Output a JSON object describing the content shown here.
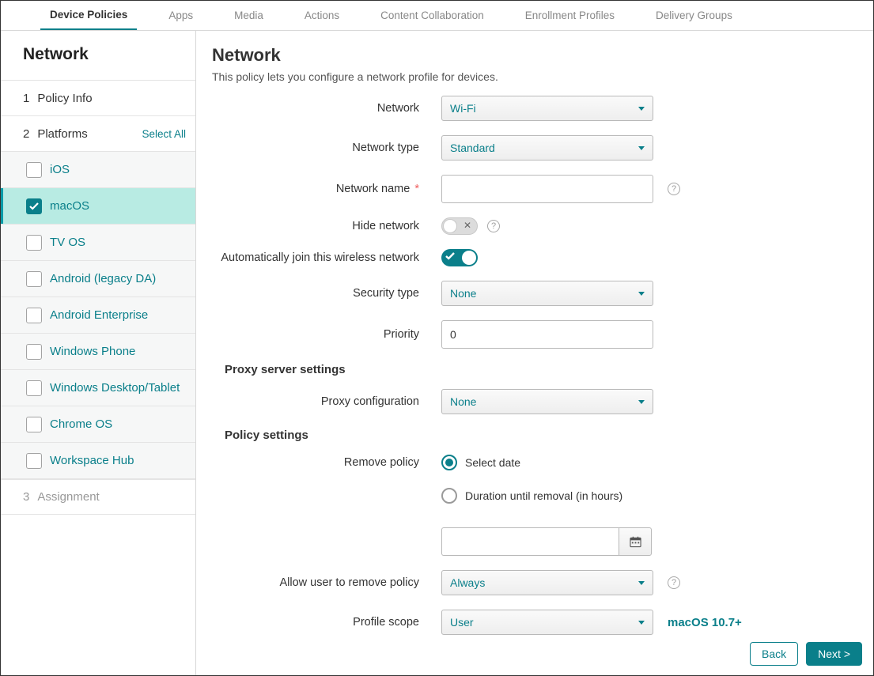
{
  "topbar": {
    "tabs": [
      "Device Policies",
      "Apps",
      "Media",
      "Actions",
      "Content Collaboration",
      "Enrollment Profiles",
      "Delivery Groups"
    ],
    "active": 0
  },
  "sidebar": {
    "title": "Network",
    "steps": {
      "policy_info": {
        "num": "1",
        "label": "Policy Info"
      },
      "platforms": {
        "num": "2",
        "label": "Platforms",
        "select_all": "Select All"
      },
      "assignment": {
        "num": "3",
        "label": "Assignment"
      }
    },
    "platforms": [
      {
        "label": "iOS",
        "checked": false
      },
      {
        "label": "macOS",
        "checked": true
      },
      {
        "label": "TV OS",
        "checked": false
      },
      {
        "label": "Android (legacy DA)",
        "checked": false
      },
      {
        "label": "Android Enterprise",
        "checked": false
      },
      {
        "label": "Windows Phone",
        "checked": false
      },
      {
        "label": "Windows Desktop/Tablet",
        "checked": false
      },
      {
        "label": "Chrome OS",
        "checked": false
      },
      {
        "label": "Workspace Hub",
        "checked": false
      }
    ]
  },
  "page": {
    "title": "Network",
    "description": "This policy lets you configure a network profile for devices."
  },
  "form": {
    "network": {
      "label": "Network",
      "value": "Wi-Fi"
    },
    "network_type": {
      "label": "Network type",
      "value": "Standard"
    },
    "network_name": {
      "label": "Network name",
      "value": "",
      "required": "*"
    },
    "hide_network": {
      "label": "Hide network",
      "value": false
    },
    "auto_join": {
      "label": "Automatically join this wireless network",
      "value": true
    },
    "security_type": {
      "label": "Security type",
      "value": "None"
    },
    "priority": {
      "label": "Priority",
      "value": "0"
    },
    "proxy_section": "Proxy server settings",
    "proxy_configuration": {
      "label": "Proxy configuration",
      "value": "None"
    },
    "policy_section": "Policy settings",
    "remove_policy": {
      "label": "Remove policy",
      "options": {
        "select_date": "Select date",
        "duration": "Duration until removal (in hours)"
      },
      "selected": "select_date",
      "date_value": ""
    },
    "allow_remove": {
      "label": "Allow user to remove policy",
      "value": "Always"
    },
    "profile_scope": {
      "label": "Profile scope",
      "value": "User",
      "badge": "macOS 10.7+"
    }
  },
  "footer": {
    "back": "Back",
    "next": "Next >"
  }
}
